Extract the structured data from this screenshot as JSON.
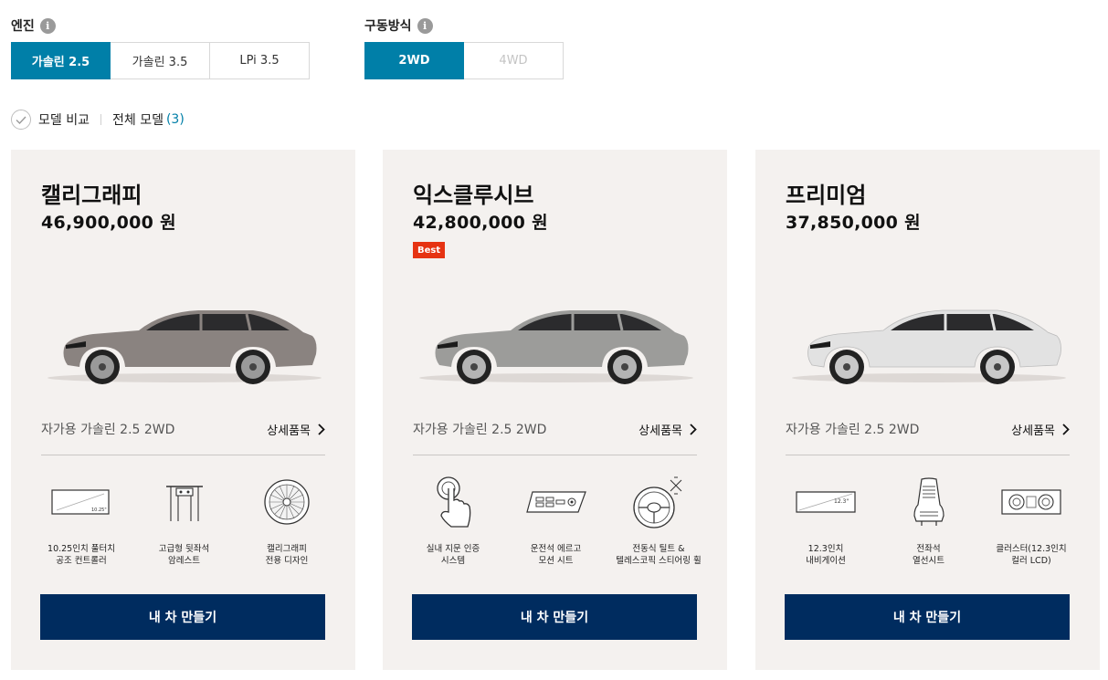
{
  "filters": {
    "engine": {
      "label": "엔진",
      "options": [
        "가솔린 2.5",
        "가솔린 3.5",
        "LPi 3.5"
      ],
      "selected": "가솔린 2.5"
    },
    "drive": {
      "label": "구동방식",
      "options": [
        "2WD",
        "4WD"
      ],
      "selected": "2WD",
      "disabled": [
        "4WD"
      ]
    },
    "info_icon": "i"
  },
  "compare": {
    "label": "모델 비교",
    "all_models": "전체 모델",
    "count": "(3)"
  },
  "models": [
    {
      "name": "캘리그래피",
      "price": "46,900,000 원",
      "badge": "",
      "car_color": "#8a8380",
      "trim": "자가용 가솔린 2.5 2WD",
      "detail": "상세품목",
      "features": [
        {
          "icon": "touch-climate-panel-icon",
          "text": "10.25인치 풀터치\n공조 컨트롤러"
        },
        {
          "icon": "rear-armrest-icon",
          "text": "고급형 뒷좌석\n암레스트"
        },
        {
          "icon": "calligraphy-wheel-icon",
          "text": "캘리그래피\n전용 디자인"
        }
      ],
      "cta": "내 차 만들기"
    },
    {
      "name": "익스클루시브",
      "price": "42,800,000 원",
      "badge": "Best",
      "car_color": "#9c9c9a",
      "trim": "자가용 가솔린 2.5 2WD",
      "detail": "상세품목",
      "features": [
        {
          "icon": "fingerprint-auth-icon",
          "text": "실내 지문 인증\n시스템"
        },
        {
          "icon": "ergo-motion-seat-icon",
          "text": "운전석 에르고\n모션 시트"
        },
        {
          "icon": "tilt-telescopic-steering-icon",
          "text": "전동식 틸트 &\n텔레스코픽 스티어링 휠"
        }
      ],
      "cta": "내 차 만들기"
    },
    {
      "name": "프리미엄",
      "price": "37,850,000 원",
      "badge": "",
      "car_color": "#e2e2e2",
      "trim": "자가용 가솔린 2.5 2WD",
      "detail": "상세품목",
      "features": [
        {
          "icon": "navigation-display-icon",
          "text": "12.3인치\n내비게이션"
        },
        {
          "icon": "heated-seat-icon",
          "text": "전좌석\n열선시트"
        },
        {
          "icon": "cluster-lcd-icon",
          "text": "클러스터(12.3인치\n컬러 LCD)"
        }
      ],
      "cta": "내 차 만들기"
    }
  ],
  "icon_labels": {
    "panel_size_1": "10.25\"",
    "panel_size_2": "12.3\""
  }
}
